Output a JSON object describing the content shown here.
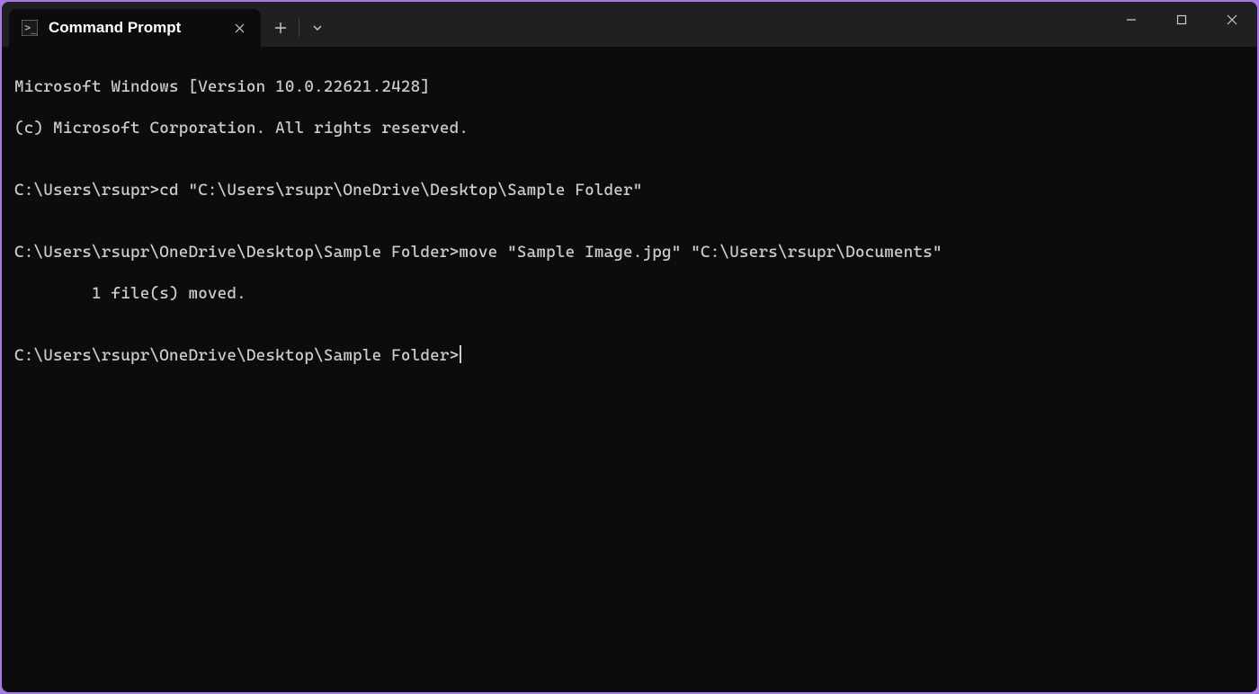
{
  "tab": {
    "title": "Command Prompt"
  },
  "terminal": {
    "line1": "Microsoft Windows [Version 10.0.22621.2428]",
    "line2": "(c) Microsoft Corporation. All rights reserved.",
    "blank1": "",
    "prompt1": "C:\\Users\\rsupr>",
    "cmd1": "cd \"C:\\Users\\rsupr\\OneDrive\\Desktop\\Sample Folder\"",
    "blank2": "",
    "prompt2": "C:\\Users\\rsupr\\OneDrive\\Desktop\\Sample Folder>",
    "cmd2": "move \"Sample Image.jpg\" \"C:\\Users\\rsupr\\Documents\"",
    "result1": "        1 file(s) moved.",
    "blank3": "",
    "prompt3": "C:\\Users\\rsupr\\OneDrive\\Desktop\\Sample Folder>"
  }
}
